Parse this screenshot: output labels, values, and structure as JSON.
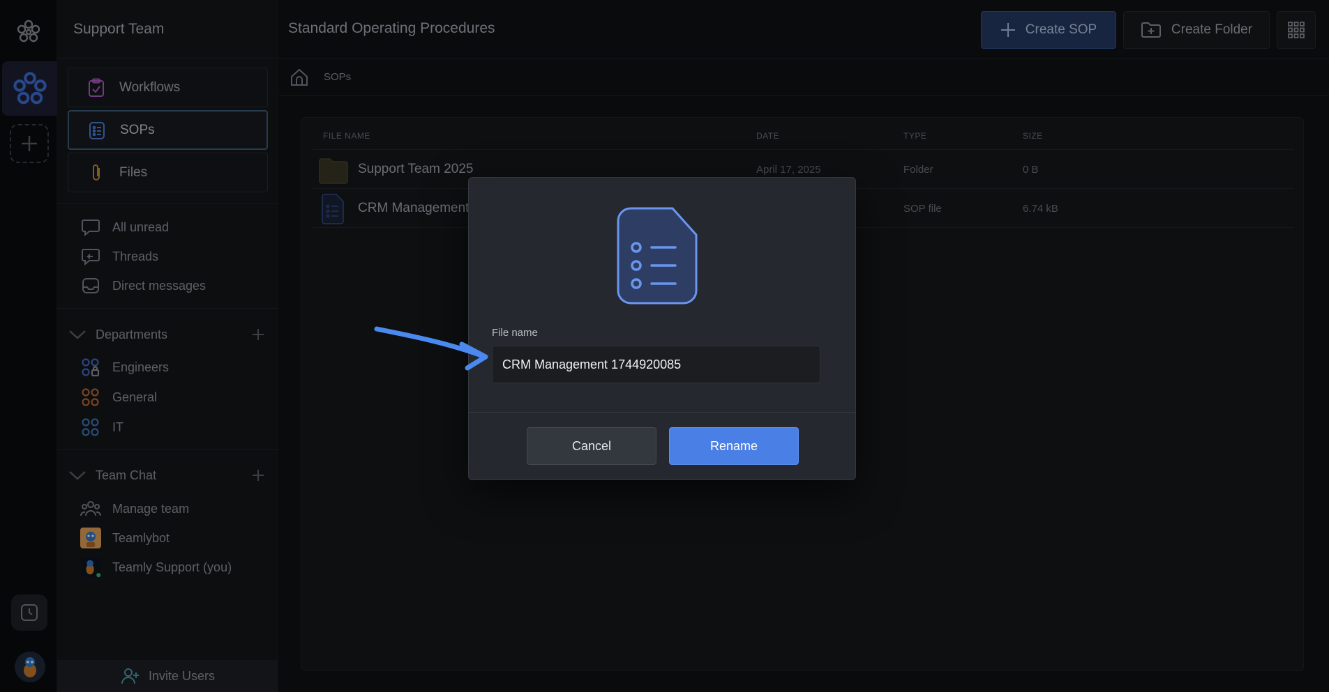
{
  "colors": {
    "accent": "#4a7fe6",
    "background": "#101114",
    "sidebar": "#14161a"
  },
  "sidebar": {
    "title": "Support Team",
    "nav": [
      {
        "label": "Workflows",
        "icon": "clipboard-check-icon"
      },
      {
        "label": "SOPs",
        "icon": "list-document-icon",
        "active": true
      },
      {
        "label": "Files",
        "icon": "paperclip-icon"
      }
    ],
    "quick": [
      {
        "label": "All unread",
        "icon": "chat-bubble-icon"
      },
      {
        "label": "Threads",
        "icon": "thread-reply-icon"
      },
      {
        "label": "Direct messages",
        "icon": "inbox-icon"
      }
    ],
    "departments": {
      "title": "Departments",
      "items": [
        {
          "label": "Engineers",
          "icon": "locked-group-icon"
        },
        {
          "label": "General",
          "icon": "group-icon"
        },
        {
          "label": "IT",
          "icon": "group-icon"
        }
      ]
    },
    "team_chat": {
      "title": "Team Chat",
      "items": [
        {
          "label": "Manage team",
          "icon": "people-icon"
        },
        {
          "label": "Teamlybot",
          "icon": "bot-avatar"
        },
        {
          "label": "Teamly Support (you)",
          "icon": "user-avatar"
        }
      ]
    },
    "invite_label": "Invite Users"
  },
  "header": {
    "title": "Standard Operating Procedures",
    "create_sop_label": "Create SOP",
    "create_folder_label": "Create Folder"
  },
  "breadcrumb": {
    "current": "SOPs"
  },
  "table": {
    "columns": [
      "FILE NAME",
      "DATE",
      "TYPE",
      "SIZE"
    ],
    "rows": [
      {
        "name": "Support Team 2025",
        "date": "April 17, 2025",
        "type": "Folder",
        "size": "0 B",
        "icon": "folder-icon"
      },
      {
        "name": "CRM Management",
        "date": "",
        "type": "SOP file",
        "size": "6.74 kB",
        "icon": "sop-file-icon"
      }
    ]
  },
  "modal": {
    "field_label": "File name",
    "field_value": "CRM Management 1744920085",
    "cancel_label": "Cancel",
    "rename_label": "Rename"
  }
}
